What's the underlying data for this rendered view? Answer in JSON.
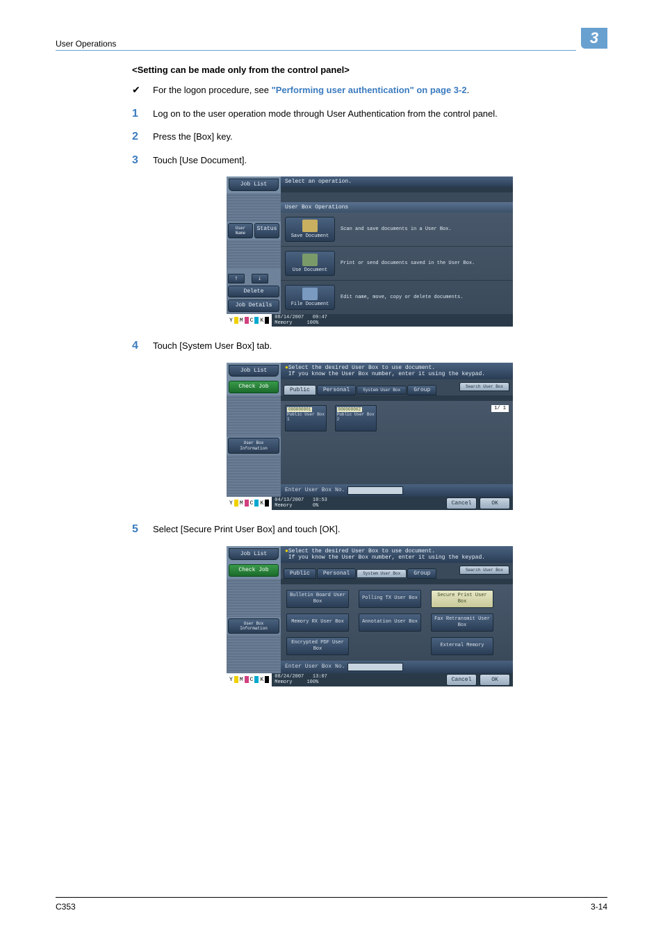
{
  "header": {
    "title": "User Operations",
    "chapter": "3"
  },
  "subtitle": "<Setting can be made only from the control panel>",
  "bullet": {
    "mark": "✔",
    "pre": "For the logon procedure, see ",
    "link": "\"Performing user authentication\" on page 3-2",
    "post": "."
  },
  "steps": {
    "s1": {
      "n": "1",
      "t": "Log on to the user operation mode through User Authentication from the control panel."
    },
    "s2": {
      "n": "2",
      "t": "Press the [Box] key."
    },
    "s3": {
      "n": "3",
      "t": "Touch [Use Document]."
    },
    "s4": {
      "n": "4",
      "t": "Touch [System User Box] tab."
    },
    "s5": {
      "n": "5",
      "t": "Select [Secure Print User Box] and touch [OK]."
    }
  },
  "ss1": {
    "job_list": "Job List",
    "select_op": "Select an operation.",
    "user_name": "User Name",
    "status": "Status",
    "up": "↑",
    "down": "↓",
    "delete": "Delete",
    "job_details": "Job Details",
    "ubo": "User Box Operations",
    "save_doc": "Save Document",
    "save_desc": "Scan and save documents in a User Box.",
    "use_doc": "Use Document",
    "use_desc": "Print or send documents saved in the User Box.",
    "file_doc": "File Document",
    "file_desc": "Edit name, move, copy or delete documents.",
    "date": "08/14/2007",
    "time": "09:47",
    "mem": "Memory",
    "mempct": "100%",
    "y": "Y",
    "m": "M",
    "c": "C",
    "k": "K"
  },
  "ss2": {
    "job_list": "Job List",
    "check_job": "Check Job",
    "user_box_info": "User Box Information",
    "hint1": "Select the desired User Box to use document.",
    "hint2": "If you know the User Box number, enter it using the keypad.",
    "public": "Public",
    "personal": "Personal",
    "system": "System User Box",
    "group": "Group",
    "search": "Search User Box",
    "b1num": "000000001",
    "b1name": "Public User Box 1",
    "b2num": "000000002",
    "b2name": "Public User Box 2",
    "page": "1/ 1",
    "enter": "Enter User Box No.",
    "cancel": "Cancel",
    "ok": "OK",
    "date": "04/13/2007",
    "time": "10:53",
    "mem": "Memory",
    "mempct": "0%",
    "y": "Y",
    "m": "M",
    "c": "C",
    "k": "K"
  },
  "ss3": {
    "job_list": "Job List",
    "check_job": "Check Job",
    "user_box_info": "User Box Information",
    "hint1": "Select the desired User Box to use document.",
    "hint2": "If you know the User Box number, enter it using the keypad.",
    "public": "Public",
    "personal": "Personal",
    "system": "System User Box",
    "group": "Group",
    "search": "Search User Box",
    "bb": "Bulletin Board User Box",
    "pt": "Polling TX User Box",
    "sp": "Secure Print User Box",
    "mr": "Memory RX User Box",
    "an": "Annotation User Box",
    "fr": "Fax Retransmit User Box",
    "ep": "Encrypted PDF User Box",
    "em": "External Memory",
    "enter": "Enter User Box No.",
    "cancel": "Cancel",
    "ok": "OK",
    "date": "08/24/2007",
    "time": "13:07",
    "mem": "Memory",
    "mempct": "100%",
    "y": "Y",
    "m": "M",
    "c": "C",
    "k": "K"
  },
  "footer": {
    "model": "C353",
    "page": "3-14"
  }
}
